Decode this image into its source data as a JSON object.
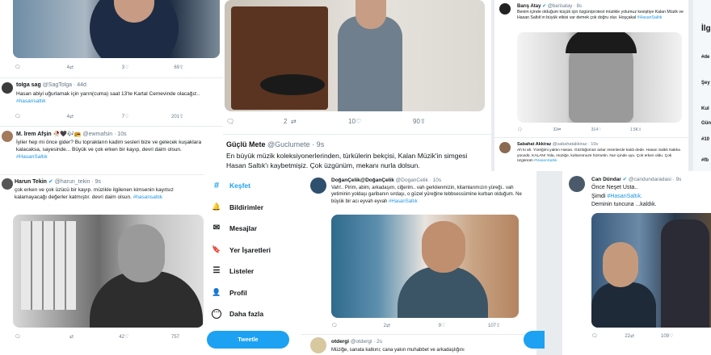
{
  "col1": {
    "top_actions": {
      "replies": "4",
      "retweets": "3",
      "likes": "69"
    },
    "tweet1": {
      "name": "tolga sag",
      "handle": "@SagTolga · 44d",
      "text": "Hasan abiyi uğurlamak için yarın(cuma) saat 13'te Kartal Cemevinde olacağız..",
      "tag": "#hasansaltık",
      "actions": {
        "replies": "4",
        "retweets": "7",
        "likes": "201"
      }
    },
    "tweet2": {
      "name": "M. İrem Afşin",
      "emojis": "🥀🖤🎶📻",
      "handle": "@ewmafsin · 10s",
      "text": "İyiler hep mi önce gider? Bu toprakların kadim sesleri bize ve gelecek kuşaklara kalacaksa, sayesinde... Büyük ve çok erken bir kayıp, devri daim olsun.",
      "tag": "#HasanSaltık"
    },
    "tweet3": {
      "name": "Harun Tekin",
      "handle": "@harun_tekin · 9s",
      "text": "çok erken ve çok üzücü bir kayıp. müzikle ilgilenen kimsenin kayıtsız kalamayacağı değerler katmıştır. devri daim olsun.",
      "tag": "#hasansaltık",
      "actions": {
        "replies": "",
        "retweets": "42",
        "likes": "757"
      }
    }
  },
  "col2": {
    "top_actions": {
      "replies": "2",
      "retweets": "10",
      "likes": "90"
    },
    "tweet1": {
      "name": "Güçlü Mete",
      "handle": "@Guclumete · 9s",
      "text": "En büyük müzik koleksiyonerlerinden, türkülerin bekçisi, Kalan Müzik'in simgesi Hasan Saltık'ı kaybetmişiz. Çok üzgünüm, mekanı nurla dolsun."
    },
    "menu": [
      {
        "label": "Keşfet",
        "icon": "hashtag-icon",
        "glyph": "#"
      },
      {
        "label": "Bildirimler",
        "icon": "bell-icon",
        "glyph": "🔔"
      },
      {
        "label": "Mesajlar",
        "icon": "envelope-icon",
        "glyph": "✉"
      },
      {
        "label": "Yer İşaretleri",
        "icon": "bookmark-icon",
        "glyph": "🔖"
      },
      {
        "label": "Listeler",
        "icon": "list-icon",
        "glyph": "☰"
      },
      {
        "label": "Profil",
        "icon": "profile-icon",
        "glyph": "👤"
      },
      {
        "label": "Daha fazla",
        "icon": "more-icon",
        "glyph": "⋯"
      }
    ],
    "tweet_button": "Tweetle"
  },
  "col3": {
    "tweet1": {
      "name": "DoğanÇelik@DoğanÇelik",
      "handle": "@DoganCelik · 10s",
      "text": "Vah!.. Pirim, abim, arkadaşım, ciğerim.. vah gerkilenmizin, kitamlarımızın yüreği.. vah yetiminin yoldaşı garibanın sırdaşı, o güzel yüreğine tebbsessümine kurban olduğum. Ne büyük bir acı eyvah eyvah",
      "tag": "#HasanSaltık",
      "actions": {
        "replies": "2",
        "retweets": "9",
        "likes": "107"
      }
    },
    "tweet2": {
      "name": "otdergi",
      "handle": "@otdergi · 2s",
      "text": "Müziğe, sanata katkını; cana yakın muhabbet ve arkadaşlığını"
    }
  },
  "col4": {
    "tweet1": {
      "name": "Barış Atay",
      "handle": "@barisatay · 8s",
      "text": "Benim içinde olduğum küçük için özgün/protest müzikle yolumuz kesiştiye Kalan Müzik ve Hasan Saltık'ın büyük etkisi var demek çok doğru olur. Hoşçakal",
      "tag": "#HasanSaltık",
      "actions": {
        "replies": "32",
        "retweets": "314",
        "likes": "1.5K"
      }
    },
    "tweet2": {
      "name": "Sabahat Akkiraz",
      "handle": "@sabahatakkiraz · 10s",
      "text": "Ah ki ah. Yüreğimi yaktın Hasan. Gözlüğümüz anlar resimlerde kaldı dede. Hasan Saltık Nakka yücedü. KALAN! Yola, müziğe, kulturomuze hizmetin. Nur içinde uyu. Çok erken oldu. Çok üzgünüm",
      "tag": "#HasanSaltık"
    }
  },
  "col5": {
    "tweet1": {
      "name": "Can Dündar",
      "handle": "@candundaradasi · 9s",
      "line1": "Önce Neşet Usta..",
      "line2_prefix": "Şimdi ",
      "line2_tag": "#HasanSaltık.",
      "line3": "Deminin tuncuna ...kaldık.",
      "actions": {
        "replies": "22",
        "retweets": "109",
        "likes": ""
      }
    }
  },
  "col6": {
    "title": "İlg",
    "lines": [
      "#de",
      "Şey",
      "Kul",
      "Gün",
      "#10",
      "#fb"
    ]
  },
  "colors": {
    "accent": "#1da1f2",
    "link": "#1b95e0",
    "muted": "#657786"
  }
}
